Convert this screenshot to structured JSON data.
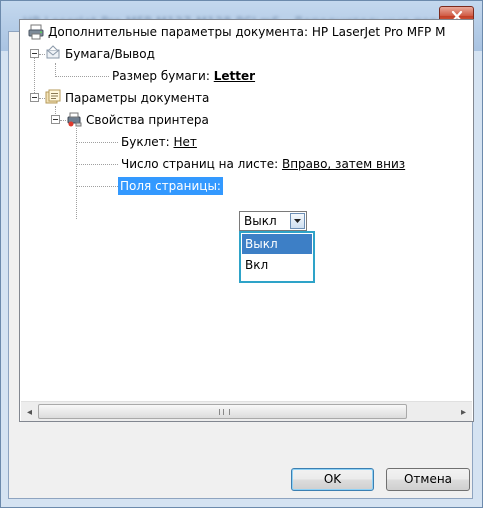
{
  "window": {
    "title": "HP LaserJet Pro MFP M127-M128 PCLmS - Дополнительные пар..."
  },
  "tree": {
    "root": {
      "label": "Дополнительные параметры документа: HP LaserJet Pro MFP M"
    },
    "paper_output": {
      "label": "Бумага/Вывод"
    },
    "paper_size": {
      "label": "Размер бумаги:",
      "value": "Letter"
    },
    "document_options": {
      "label": "Параметры документа"
    },
    "printer_features": {
      "label": "Свойства принтера"
    },
    "booklet": {
      "label": "Буклет:",
      "value": "Нет"
    },
    "pages_per_sheet": {
      "label": "Число страниц на листе:",
      "value": "Вправо, затем вниз"
    },
    "page_borders": {
      "label": "Поля страницы:",
      "combo_value": "Выкл",
      "options": [
        "Выкл",
        "Вкл"
      ]
    }
  },
  "scrollbar": {
    "left_arrow": "◂",
    "right_arrow": "▸"
  },
  "buttons": {
    "ok": "OK",
    "cancel": "Отмена"
  }
}
